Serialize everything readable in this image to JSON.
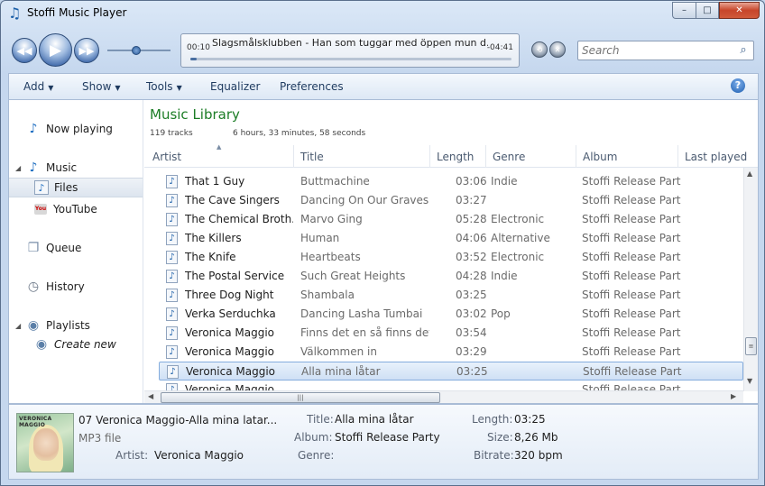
{
  "window": {
    "title": "Stoffi Music Player",
    "minimize_glyph": "–",
    "maximize_glyph": "□",
    "close_glyph": "✕"
  },
  "playback": {
    "elapsed": "00:10",
    "remaining": "-04:41",
    "now_playing": "Slagsmålsklubben - Han som tuggar med öppen mun d...",
    "progress_fraction": 0.02,
    "volume_fraction": 0.45
  },
  "search": {
    "placeholder": "Search"
  },
  "menu": {
    "items": [
      "Add",
      "Show",
      "Tools",
      "Equalizer",
      "Preferences"
    ],
    "has_arrow": [
      true,
      true,
      true,
      false,
      false
    ]
  },
  "nav": {
    "now_playing": "Now playing",
    "music": "Music",
    "files": "Files",
    "youtube": "YouTube",
    "youtube_icon_text": "You",
    "queue": "Queue",
    "history": "History",
    "playlists": "Playlists",
    "create_new": "Create new"
  },
  "library": {
    "title": "Music Library",
    "track_count": "119 tracks",
    "duration": "6 hours, 33 minutes, 58 seconds",
    "columns": [
      "Artist",
      "Title",
      "Length",
      "Genre",
      "Album",
      "Last played"
    ],
    "rows": [
      {
        "artist": "That 1 Guy",
        "title": "Buttmachine",
        "length": "03:06",
        "genre": "Indie",
        "album": "Stoffi Release Party"
      },
      {
        "artist": "The Cave Singers",
        "title": "Dancing On Our Graves",
        "length": "03:27",
        "genre": "",
        "album": "Stoffi Release Party"
      },
      {
        "artist": "The Chemical Broth...",
        "title": "Marvo Ging",
        "length": "05:28",
        "genre": "Electronic",
        "album": "Stoffi Release Party"
      },
      {
        "artist": "The Killers",
        "title": "Human",
        "length": "04:06",
        "genre": "Alternative",
        "album": "Stoffi Release Party"
      },
      {
        "artist": "The Knife",
        "title": "Heartbeats",
        "length": "03:52",
        "genre": "Electronic",
        "album": "Stoffi Release Party"
      },
      {
        "artist": "The Postal Service",
        "title": "Such Great Heights",
        "length": "04:28",
        "genre": "Indie",
        "album": "Stoffi Release Party"
      },
      {
        "artist": "Three Dog Night",
        "title": "Shambala",
        "length": "03:25",
        "genre": "",
        "album": "Stoffi Release Party"
      },
      {
        "artist": "Verka Serduchka",
        "title": "Dancing Lasha Tumbai",
        "length": "03:02",
        "genre": "Pop",
        "album": "Stoffi Release Party"
      },
      {
        "artist": "Veronica Maggio",
        "title": "Finns det en så finns det...",
        "length": "03:54",
        "genre": "",
        "album": "Stoffi Release Party"
      },
      {
        "artist": "Veronica Maggio",
        "title": "Välkommen in",
        "length": "03:29",
        "genre": "",
        "album": "Stoffi Release Party"
      },
      {
        "artist": "Veronica Maggio",
        "title": "Alla mina låtar",
        "length": "03:25",
        "genre": "",
        "album": "Stoffi Release Party"
      },
      {
        "artist": "Veronica Maggio",
        "title": "",
        "length": "",
        "genre": "",
        "album": "Stoffi Release Party"
      }
    ],
    "selected_row": 10
  },
  "details": {
    "filename": "07 Veronica Maggio-Alla mina latar...",
    "filetype": "MP3 file",
    "cover_text": "VERONICA MAGGIO",
    "artist_label": "Artist:",
    "artist": "Veronica Maggio",
    "title_label": "Title:",
    "title": "Alla mina låtar",
    "album_label": "Album:",
    "album": "Stoffi Release Party",
    "genre_label": "Genre:",
    "genre": "",
    "length_label": "Length:",
    "length": "03:25",
    "size_label": "Size:",
    "size": "8,26 Mb",
    "bitrate_label": "Bitrate:",
    "bitrate": "320 bpm"
  },
  "colors": {
    "accent": "#1c7d26",
    "selection": "#cfe0f5"
  }
}
